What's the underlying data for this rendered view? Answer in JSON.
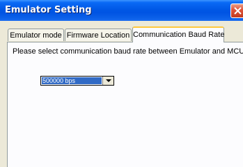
{
  "window": {
    "title": "Emulator Setting"
  },
  "tabs": [
    {
      "label": "Emulator mode",
      "active": false
    },
    {
      "label": "Firmware Location",
      "active": false
    },
    {
      "label": "Communication Baud Rate",
      "active": true
    }
  ],
  "panel": {
    "instruction": "Please select communication baud rate between Emulator and MCU."
  },
  "baud_rate_select": {
    "selected_value": "500000 bps",
    "icon": "chevron-down-icon"
  },
  "colors": {
    "titlebar": "#0054e3",
    "window_bg": "#ece9d8",
    "panel_bg": "#fcfcfe",
    "selection": "#316ac5",
    "active_tab_accent": "#ffc83c",
    "close_button": "#e0553b"
  }
}
